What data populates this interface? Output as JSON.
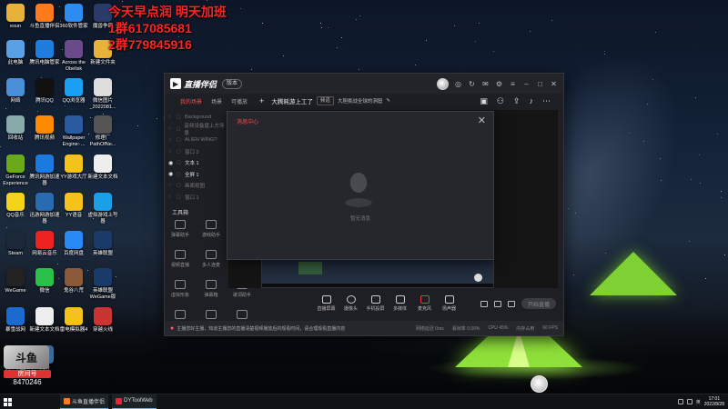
{
  "overlay": {
    "line1": "今天早点润 明天加班",
    "line2": "1群617085681",
    "line3": "2群779845916"
  },
  "desktop_icons": [
    {
      "label": "esun",
      "icon": "user-folder-icon",
      "color": "#e6b23a"
    },
    {
      "label": "斗鱼直播伴侣",
      "icon": "douyu-icon",
      "color": "#ff7a1a"
    },
    {
      "label": "360软件管家",
      "icon": "360-icon",
      "color": "#2d8cf0"
    },
    {
      "label": "魔兽争霸",
      "icon": "game-icon",
      "color": "#2a3b6b"
    },
    {
      "label": "此电脑",
      "icon": "computer-icon",
      "color": "#5aa0e6"
    },
    {
      "label": "腾讯电脑管家",
      "icon": "shield-icon",
      "color": "#1f7de0"
    },
    {
      "label": "Across the Obelisk",
      "icon": "game-icon",
      "color": "#6a4a8a"
    },
    {
      "label": "新建文件夹",
      "icon": "folder-icon",
      "color": "#e6b23a"
    },
    {
      "label": "网络",
      "icon": "network-icon",
      "color": "#4a90d9"
    },
    {
      "label": "腾讯QQ",
      "icon": "qq-icon",
      "color": "#111"
    },
    {
      "label": "QQ浏览器",
      "icon": "browser-icon",
      "color": "#1aa0f5"
    },
    {
      "label": "微信图片_2022081...",
      "icon": "image-icon",
      "color": "#ddd"
    },
    {
      "label": "回收站",
      "icon": "recycle-bin-icon",
      "color": "#8aa"
    },
    {
      "label": "腾讯视频",
      "icon": "video-icon",
      "color": "#ff8a00"
    },
    {
      "label": "Wallpaper Engine: ...",
      "icon": "wallpaper-icon",
      "color": "#2a5aa0"
    },
    {
      "label": "修理厂 PathOfNe...",
      "icon": "game-icon",
      "color": "#555"
    },
    {
      "label": "GeForce Experience",
      "icon": "nvidia-icon",
      "color": "#6aaa1a"
    },
    {
      "label": "腾讯网游加速器",
      "icon": "accelerator-icon",
      "color": "#1a7ae0"
    },
    {
      "label": "YY游戏大厅",
      "icon": "yy-icon",
      "color": "#f5c21a"
    },
    {
      "label": "新建文本文档",
      "icon": "text-file-icon",
      "color": "#eee"
    },
    {
      "label": "QQ音乐",
      "icon": "music-icon",
      "color": "#f5d21a"
    },
    {
      "label": "迅游网游加速器",
      "icon": "game-accelerator-icon",
      "color": "#2a6ab0"
    },
    {
      "label": "YY语音",
      "icon": "yy-voice-icon",
      "color": "#f5c21a"
    },
    {
      "label": "虚拟游戏上号器",
      "icon": "game-icon",
      "color": "#1aa0e6"
    },
    {
      "label": "Steam",
      "icon": "steam-icon",
      "color": "#1b2838"
    },
    {
      "label": "网易云音乐",
      "icon": "netease-music-icon",
      "color": "#e22"
    },
    {
      "label": "百度网盘",
      "icon": "cloud-drive-icon",
      "color": "#2a8af5"
    },
    {
      "label": "英雄联盟",
      "icon": "lol-icon",
      "color": "#1a3a6a"
    },
    {
      "label": "WeGame",
      "icon": "wegame-icon",
      "color": "#222"
    },
    {
      "label": "微信",
      "icon": "wechat-icon",
      "color": "#2ac04a"
    },
    {
      "label": "鬼谷八荒",
      "icon": "game-icon",
      "color": "#8a5a3a"
    },
    {
      "label": "英雄联盟WeGame版",
      "icon": "lol-icon",
      "color": "#1a3a6a"
    },
    {
      "label": "暴雪战网",
      "icon": "battlenet-icon",
      "color": "#1a6ad0"
    },
    {
      "label": "新建文本文档",
      "icon": "text-file-icon",
      "color": "#eee"
    },
    {
      "label": "雷电模拟器4",
      "icon": "emulator-icon",
      "color": "#f5c21a"
    },
    {
      "label": "穿越火线",
      "icon": "cf-icon",
      "color": "#c33"
    },
    {
      "label": "英雄联盟",
      "icon": "lol-icon",
      "color": "#1a3a6a"
    },
    {
      "label": "奥斯",
      "icon": "game-icon",
      "color": "#3a6a9a"
    }
  ],
  "app": {
    "name": "直播伴侣",
    "version_pill": "版本",
    "tabs": [
      {
        "label": "我的场景",
        "active": true
      },
      {
        "label": "场景"
      },
      {
        "label": "可播放"
      }
    ],
    "room_title": "大腾耗游上工了",
    "room_tag": "频道",
    "room_subtitle": "大胆挑战全球的洞窟",
    "layers": [
      {
        "label": "Background",
        "on": false
      },
      {
        "label": "音频设备盘上方场景",
        "on": false
      },
      {
        "label": "ALIEN WING?",
        "on": false
      },
      {
        "label": "窗口 2",
        "on": false
      },
      {
        "label": "文本 1",
        "on": true
      },
      {
        "label": "全屏 1",
        "on": true
      },
      {
        "label": "画面视图",
        "on": false
      },
      {
        "label": "窗口 1",
        "on": false
      }
    ],
    "toolbox_title": "工具箱",
    "tools": [
      {
        "label": "弹幕助手"
      },
      {
        "label": "游戏助手"
      },
      {
        "label": "视频直播"
      },
      {
        "label": "多人连麦"
      },
      {
        "label": "摄屏幕"
      },
      {
        "label": "虚拟形象"
      },
      {
        "label": "弹幕箱"
      },
      {
        "label": "歌词助手"
      },
      {
        "label": "特效"
      },
      {
        "label": "录制"
      },
      {
        "label": "更多"
      }
    ],
    "bottom_tools": [
      {
        "label": "直播屏幕",
        "icon": "screen-icon"
      },
      {
        "label": "摄像头",
        "icon": "camera-icon"
      },
      {
        "label": "手机投屏",
        "icon": "phone-cast-icon"
      },
      {
        "label": "多媒体",
        "icon": "media-icon"
      },
      {
        "label": "麦克风",
        "icon": "microphone-icon"
      },
      {
        "label": "扬声器",
        "icon": "speaker-icon"
      }
    ],
    "go_live_label": "开始直播",
    "status_warning": "主播您好主播，知道主播您的直播清楚视频播放后的观看时间，请合理观看直播内容",
    "stats": [
      "网络延迟 0ms",
      "丢帧率 0.00%",
      "CPU 45%",
      "内存占用",
      "60 FPS"
    ]
  },
  "dialog": {
    "title": "消息中心",
    "empty_text": "暂无消息"
  },
  "streamer": {
    "badge": "斗鱼",
    "room_label": "房间号",
    "room_number": "8470246"
  },
  "taskbar": {
    "apps": [
      {
        "label": "斗鱼直播伴侣",
        "color": "#ff7a1a"
      },
      {
        "label": "DYToolWeb",
        "color": "#e23"
      }
    ],
    "tray": "英",
    "time": "17:01",
    "date": "2022/8/28"
  }
}
